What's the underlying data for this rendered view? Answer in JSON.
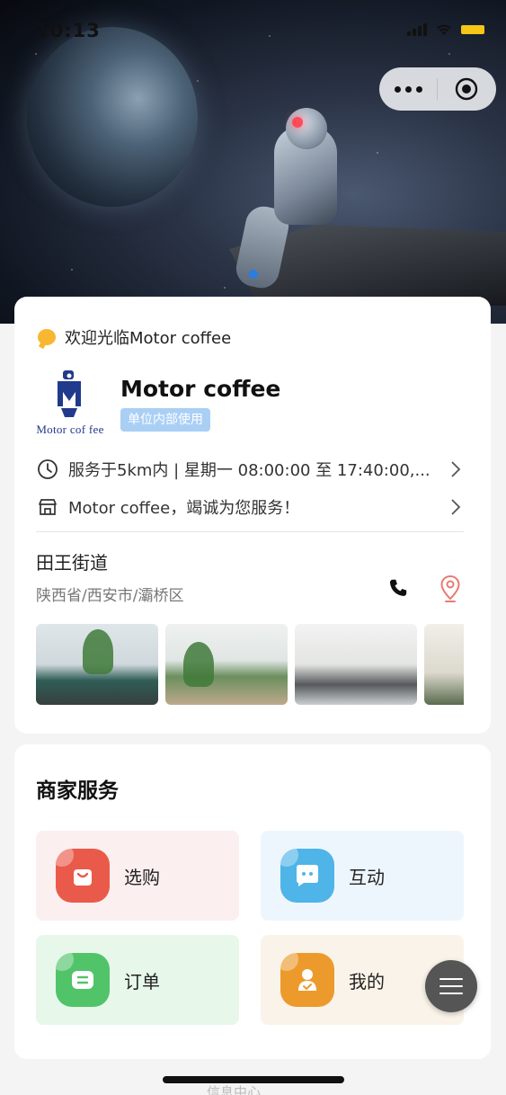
{
  "status_bar": {
    "time": "10:13"
  },
  "capsule": {
    "more_icon": "more-dots-icon",
    "close_icon": "target-close-icon"
  },
  "store": {
    "welcome": "欢迎光临Motor coffee",
    "logo_text": "Motor cof fee",
    "name": "Motor coffee",
    "badge": "单位内部使用",
    "hours": "服务于5km内 | 星期一 08:00:00 至 17:40:00,...",
    "notice": "Motor coffee，竭诚为您服务！",
    "street": "田王街道",
    "region": "陕西省/西安市/灞桥区"
  },
  "services": {
    "title": "商家服务",
    "items": [
      {
        "label": "选购",
        "icon": "shopping-bag-icon"
      },
      {
        "label": "互动",
        "icon": "chat-bubble-icon"
      },
      {
        "label": "订单",
        "icon": "order-list-icon"
      },
      {
        "label": "我的",
        "icon": "user-profile-icon"
      }
    ]
  },
  "bottom_peek": "信息中心",
  "colors": {
    "badge": "#a9cff5",
    "shop": "#ea5a4a",
    "interact": "#4fb4e8",
    "order": "#51c46a",
    "mine": "#ed9a2c",
    "banner_dot": "#2a7de1"
  }
}
